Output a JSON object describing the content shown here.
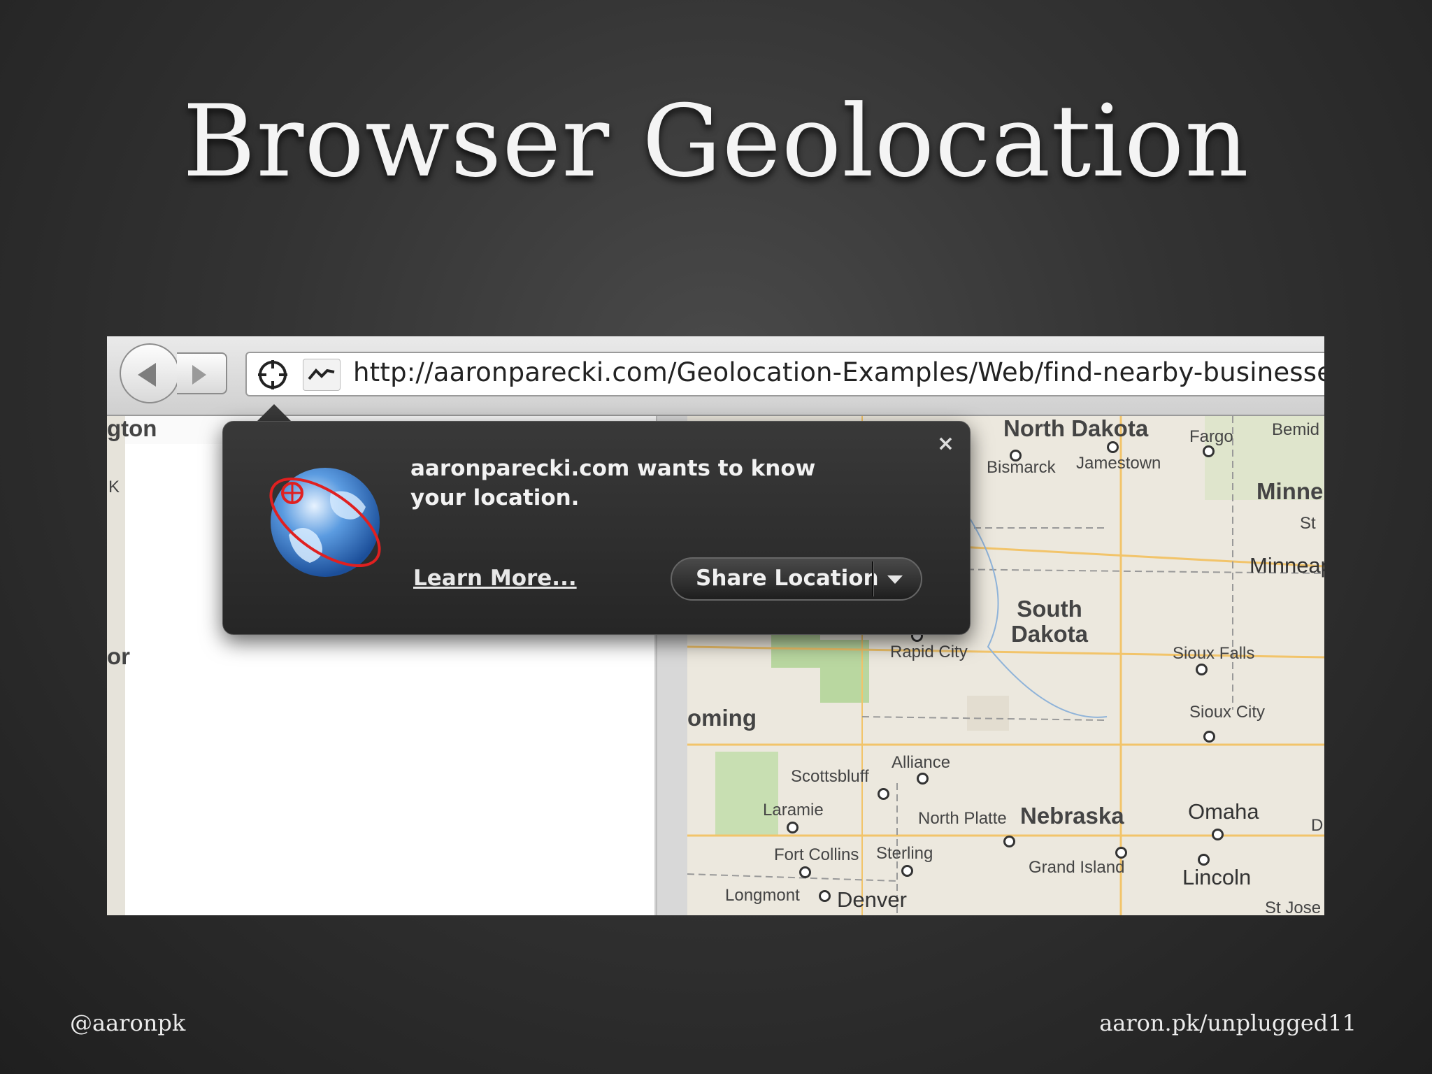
{
  "slide": {
    "title": "Browser Geolocation",
    "footer_left": "@aaronpk",
    "footer_right": "aaron.pk/unplugged11"
  },
  "browser": {
    "url": "http://aaronparecki.com/Geolocation-Examples/Web/find-nearby-businesses/"
  },
  "popup": {
    "message": "aaronparecki.com wants to know your location.",
    "learn_more": "Learn More...",
    "share_button": "Share Location",
    "close": "×"
  },
  "map": {
    "states": [
      "North Dakota",
      "South Dakota",
      "Nebraska",
      "Minne",
      "oming"
    ],
    "cities": [
      "Bismarck",
      "Jamestown",
      "Fargo",
      "Bemid",
      "St",
      "Minneap",
      "Rapid City",
      "Sioux Falls",
      "Sioux City",
      "Alliance",
      "Scottsbluff",
      "Laramie",
      "North Platte",
      "Omaha",
      "D",
      "Fort Collins",
      "Sterling",
      "Grand Island",
      "Lincoln",
      "Longmont",
      "Denver",
      "St Jose"
    ],
    "partial_left": [
      "gton",
      "K",
      "or"
    ]
  }
}
